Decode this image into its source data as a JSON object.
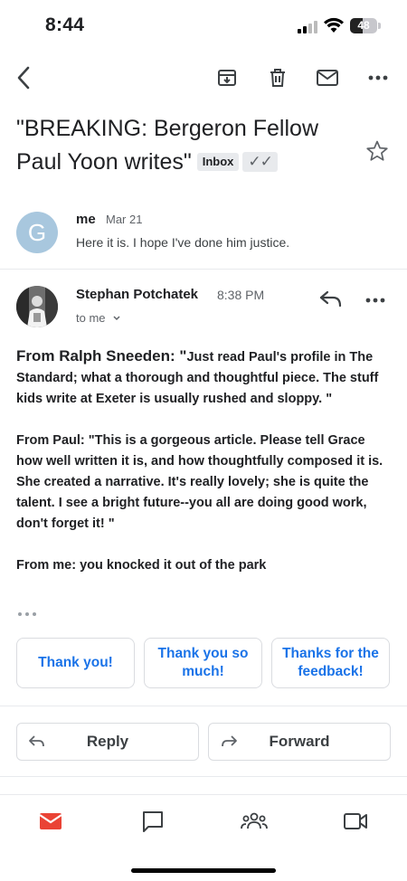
{
  "status": {
    "time": "8:44",
    "battery": "48",
    "battery_level": 0.48
  },
  "toolbar": {
    "back": "back-icon",
    "archive": "archive-icon",
    "delete": "trash-icon",
    "mark_unread": "mail-icon",
    "more": "more-icon"
  },
  "subject": {
    "title": "\"BREAKING: Bergeron Fellow Paul Yoon writes\"",
    "label_inbox": "Inbox",
    "label_check": "✓✓"
  },
  "message1": {
    "avatar_letter": "G",
    "from": "me",
    "date": "Mar 21",
    "snippet": "Here it is. I hope I've done him justice."
  },
  "message2": {
    "from": "Stephan Potchatek",
    "time": "8:38 PM",
    "to": "to me",
    "body": {
      "p1_lead": "From Ralph Sneeden: \"",
      "p1_rest": "Just read Paul's profile in The Standard; what a thorough and thoughtful piece. The stuff kids write at Exeter is usually rushed and sloppy. \"",
      "p2": "From Paul: \"This is a gorgeous article. Please tell Grace how well written it is, and how thoughtfully composed it is. She created a narrative. It's really lovely; she is quite the talent. I see a bright future--you all are doing good work, don't forget it! \"",
      "p3": "From me: you knocked it out of the park"
    }
  },
  "smart_replies": [
    "Thank you!",
    "Thank you so much!",
    "Thanks for the feedback!"
  ],
  "actions": {
    "reply": "Reply",
    "forward": "Forward"
  },
  "bottom_nav": [
    "mail-icon",
    "chat-icon",
    "spaces-icon",
    "meet-icon"
  ],
  "colors": {
    "accent": "#1a73e8",
    "mail_red": "#ea4335",
    "avatar_blue": "#a8c7de"
  }
}
